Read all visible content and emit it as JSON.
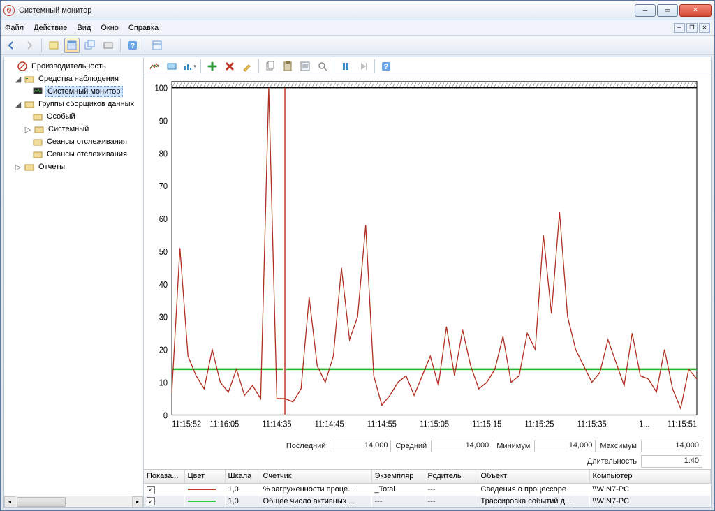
{
  "window": {
    "title": "Системный монитор"
  },
  "menu": {
    "file": "Файл",
    "action": "Действие",
    "view": "Вид",
    "window": "Окно",
    "help": "Справка"
  },
  "tree": {
    "root": "Производительность",
    "tools": "Средства наблюдения",
    "systemmon": "Системный монитор",
    "collectors": "Группы сборщиков данных",
    "custom": "Особый",
    "system": "Системный",
    "trace1": "Сеансы отслеживания",
    "trace2": "Сеансы отслеживания",
    "reports": "Отчеты"
  },
  "stats": {
    "last_label": "Последний",
    "last": "14,000",
    "avg_label": "Средний",
    "avg": "14,000",
    "min_label": "Минимум",
    "min": "14,000",
    "max_label": "Максимум",
    "max": "14,000",
    "dur_label": "Длительность",
    "dur": "1:40"
  },
  "columns": {
    "show": "Показа...",
    "color": "Цвет",
    "scale": "Шкала",
    "counter": "Счетчик",
    "instance": "Экземпляр",
    "parent": "Родитель",
    "object": "Объект",
    "computer": "Компьютер"
  },
  "rows": [
    {
      "scale": "1,0",
      "counter": "% загруженности проце...",
      "instance": "_Total",
      "parent": "---",
      "object": "Сведения о процессоре",
      "computer": "\\\\WIN7-PC",
      "color": "#c0392b"
    },
    {
      "scale": "1,0",
      "counter": "Общее число активных ...",
      "instance": "---",
      "parent": "---",
      "object": "Трассировка событий д...",
      "computer": "\\\\WIN7-PC",
      "color": "#2ecc40"
    }
  ],
  "chart_data": {
    "type": "line",
    "ylim": [
      0,
      100
    ],
    "yticks": [
      0,
      10,
      20,
      30,
      40,
      50,
      60,
      70,
      80,
      90,
      100
    ],
    "xlabels": [
      "11:15:52",
      "11:16:05",
      "11:14:35",
      "11:14:45",
      "11:14:55",
      "11:15:05",
      "11:15:15",
      "11:15:25",
      "11:15:35",
      "1...",
      "11:15:51"
    ],
    "hline_green": 14,
    "split_at": 14,
    "series": [
      {
        "name": "% загруженности процессора",
        "color": "#b03022",
        "values": [
          7,
          51,
          18,
          12,
          8,
          20,
          10,
          7,
          14,
          6,
          9,
          5,
          100,
          5,
          5,
          4,
          8,
          36,
          15,
          10,
          18,
          45,
          23,
          30,
          58,
          12,
          3,
          6,
          10,
          12,
          6,
          12,
          18,
          9,
          27,
          12,
          26,
          15,
          8,
          10,
          14,
          24,
          10,
          12,
          25,
          20,
          55,
          31,
          62,
          30,
          20,
          15,
          10,
          13,
          23,
          16,
          9,
          25,
          12,
          11,
          7,
          20,
          8,
          2,
          14,
          11
        ]
      },
      {
        "name": "Общее число активных сеансов",
        "color": "#2ecc40",
        "constant": 14
      }
    ]
  }
}
